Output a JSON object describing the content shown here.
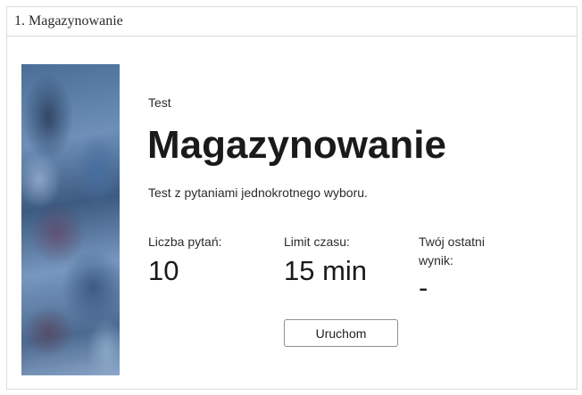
{
  "header": {
    "title": "1. Magazynowanie"
  },
  "quiz": {
    "type_label": "Test",
    "title": "Magazynowanie",
    "description": "Test z pytaniami jednokrotnego wyboru.",
    "stats": [
      {
        "label": "Liczba pytań:",
        "value": "10"
      },
      {
        "label": "Limit czasu:",
        "value": "15 min"
      },
      {
        "label": "Twój ostatni wynik:",
        "value": "-"
      }
    ],
    "start_button_label": "Uruchom"
  },
  "colors": {
    "border": "#dcdcdc",
    "cover_base": "#4a6e96"
  }
}
